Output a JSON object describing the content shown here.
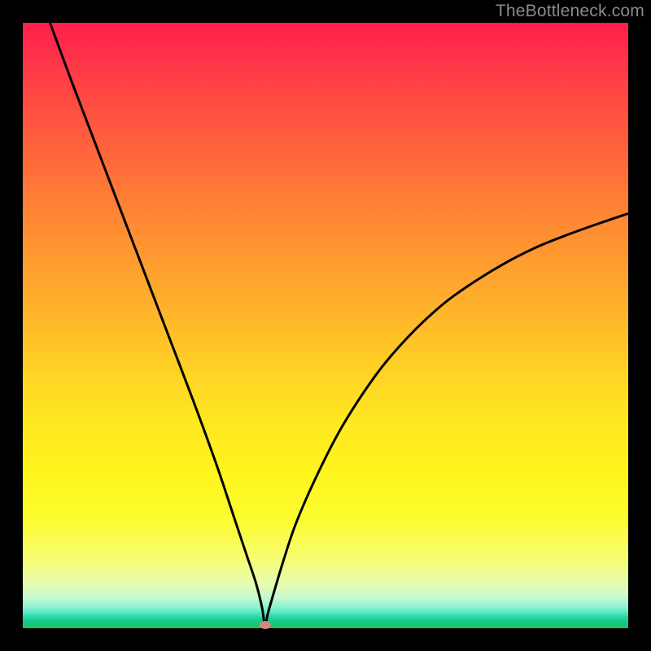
{
  "watermark": "TheBottleneck.com",
  "chart_data": {
    "type": "line",
    "title": "",
    "xlabel": "",
    "ylabel": "",
    "xlim": [
      0,
      100
    ],
    "ylim": [
      0,
      100
    ],
    "grid": false,
    "background_gradient": {
      "top_color": "#ff1f4b",
      "mid_color": "#ffe820",
      "bottom_color": "#17c564",
      "description": "vertical red-to-yellow-to-green gradient"
    },
    "series": [
      {
        "name": "bottleneck-curve",
        "color": "#000000",
        "x": [
          4.5,
          8,
          12,
          16,
          20,
          24,
          28,
          32,
          35,
          37,
          38.5,
          39.5,
          40,
          40.5,
          41.5,
          43,
          45,
          48,
          52,
          56,
          60,
          65,
          70,
          75,
          80,
          85,
          90,
          95,
          100
        ],
        "y": [
          100,
          90.5,
          80,
          69.5,
          59,
          48.5,
          38,
          27,
          18,
          12,
          7.5,
          3.5,
          0.5,
          2.5,
          6,
          11,
          17,
          24,
          32,
          38.5,
          44,
          49.5,
          54,
          57.5,
          60.5,
          63,
          65,
          66.8,
          68.5
        ]
      }
    ],
    "marker": {
      "name": "optimal-point",
      "color": "#d18b7a",
      "x": 40,
      "y": 0.5
    }
  }
}
